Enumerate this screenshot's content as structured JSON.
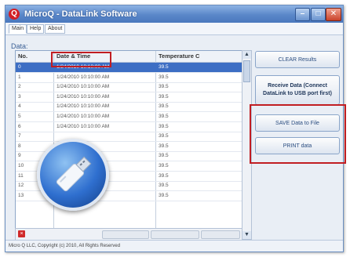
{
  "window": {
    "title": "MicroQ - DataLink Software",
    "app_icon": "Q",
    "minimize_icon": "minimize-icon",
    "maximize_icon": "maximize-icon",
    "close_icon": "close-icon"
  },
  "menu": {
    "tabs": [
      "Main",
      "Help",
      "About"
    ],
    "active": "Main"
  },
  "data_section": {
    "label": "Data:",
    "columns": [
      "No.",
      "Date & Time",
      "Temperature C"
    ],
    "rows": [
      [
        "0",
        "1/24/2010 10:10:00 AM",
        "39.5"
      ],
      [
        "1",
        "1/24/2010 10:10:00 AM",
        "39.5"
      ],
      [
        "2",
        "1/24/2010 10:10:00 AM",
        "39.5"
      ],
      [
        "3",
        "1/24/2010 10:10:00 AM",
        "39.5"
      ],
      [
        "4",
        "1/24/2010 10:10:00 AM",
        "39.5"
      ],
      [
        "5",
        "1/24/2010 10:10:00 AM",
        "39.5"
      ],
      [
        "6",
        "1/24/2010 10:10:00 AM",
        "39.5"
      ],
      [
        "7",
        "",
        "39.5"
      ],
      [
        "8",
        "",
        "39.5"
      ],
      [
        "9",
        "",
        "39.5"
      ],
      [
        "10",
        "",
        "39.5"
      ],
      [
        "11",
        "",
        "39.5"
      ],
      [
        "12",
        "",
        "39.5"
      ],
      [
        "13",
        "",
        "39.5"
      ]
    ],
    "selected_row": 0
  },
  "buttons": {
    "clear": "CLEAR Results",
    "receive": "Receive Data (Connect DataLink to USB port first)",
    "save": "SAVE Data to File",
    "print": "PRINT data"
  },
  "status": {
    "text": "Micro Q LLC, Copyright (c) 2010, All Rights Reserved"
  },
  "colors": {
    "highlight": "#c11d22",
    "title_bar": "#5a87c9",
    "selection": "#3d6ec4"
  }
}
